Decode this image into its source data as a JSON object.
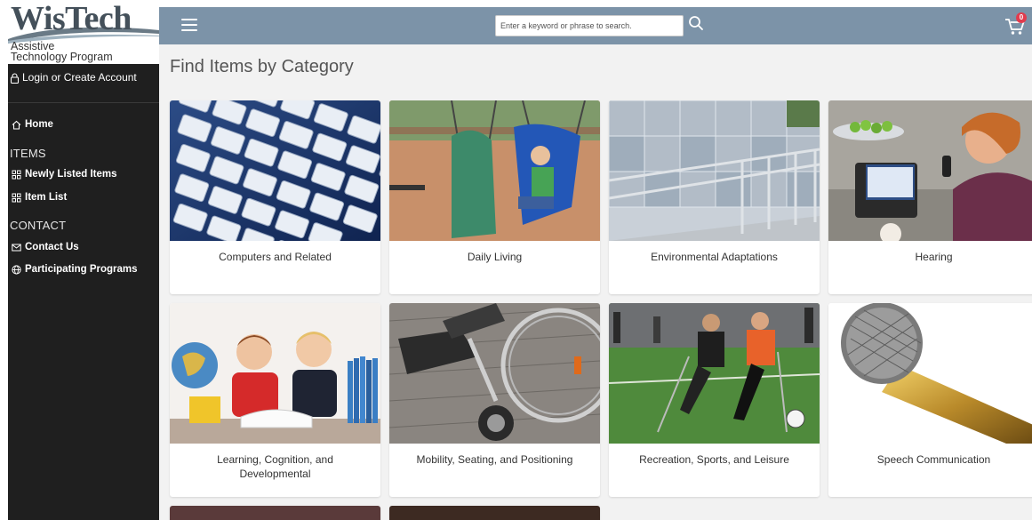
{
  "brand": {
    "logo_title": "WisTech",
    "logo_sub1": "Assistive",
    "logo_sub2": "Technology Program"
  },
  "account": {
    "login_label": "Login or Create Account"
  },
  "sidebar": {
    "home_label": "Home",
    "items_heading": "ITEMS",
    "items": [
      {
        "label": "Newly Listed Items",
        "icon": "grid-icon"
      },
      {
        "label": "Item List",
        "icon": "grid-icon"
      }
    ],
    "contact_heading": "CONTACT",
    "contact": [
      {
        "label": "Contact Us",
        "icon": "envelope-icon"
      },
      {
        "label": "Participating Programs",
        "icon": "globe-icon"
      }
    ]
  },
  "topbar": {
    "search_placeholder": "Enter a keyword or phrase to search.",
    "cart_count": "0"
  },
  "main": {
    "title": "Find Items by Category",
    "categories": [
      {
        "label": "Computers and Related"
      },
      {
        "label": "Daily Living"
      },
      {
        "label": "Environmental Adaptations"
      },
      {
        "label": "Hearing"
      },
      {
        "label": "Learning, Cognition, and Developmental"
      },
      {
        "label": "Mobility, Seating, and Positioning"
      },
      {
        "label": "Recreation, Sports, and Leisure"
      },
      {
        "label": "Speech Communication"
      }
    ]
  },
  "colors": {
    "topbar": "#7c93a8",
    "sidebar": "#1f1f1f",
    "main_bg": "#f2f2f2",
    "badge": "#e23b4d"
  }
}
